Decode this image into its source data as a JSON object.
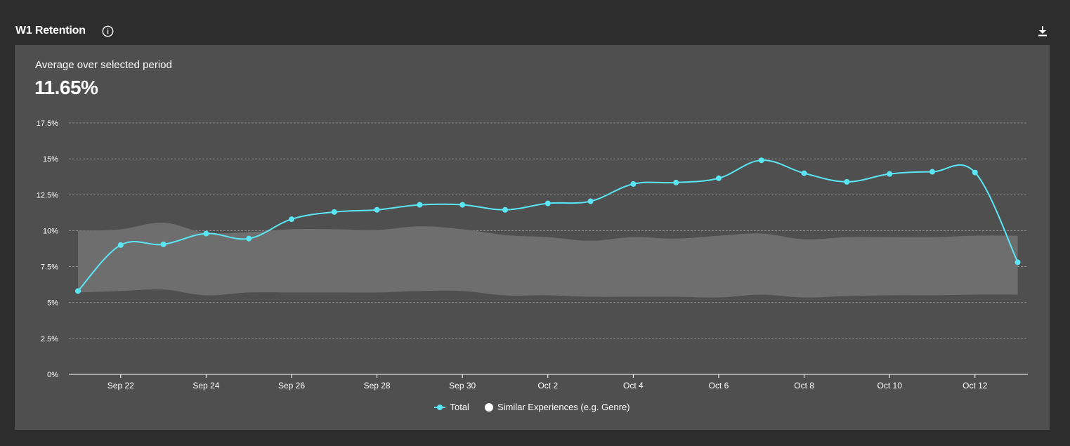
{
  "header": {
    "title": "W1 Retention",
    "info_icon": "info-circle-icon",
    "download_icon": "download-icon"
  },
  "summary": {
    "label": "Average over selected period",
    "value": "11.65%"
  },
  "colors": {
    "total": "#5ae6f5",
    "similar_band": "#6e6e6e",
    "panel": "#4f4f4f",
    "background": "#2d2d2d"
  },
  "chart_data": {
    "type": "line",
    "x": [
      "Sep 21",
      "Sep 22",
      "Sep 23",
      "Sep 24",
      "Sep 25",
      "Sep 26",
      "Sep 27",
      "Sep 28",
      "Sep 29",
      "Sep 30",
      "Oct 1",
      "Oct 2",
      "Oct 3",
      "Oct 4",
      "Oct 5",
      "Oct 6",
      "Oct 7",
      "Oct 8",
      "Oct 9",
      "Oct 10",
      "Oct 11",
      "Oct 12",
      "Oct 13"
    ],
    "x_tick_labels": [
      "Sep 22",
      "Sep 24",
      "Sep 26",
      "Sep 28",
      "Sep 30",
      "Oct 2",
      "Oct 4",
      "Oct 6",
      "Oct 8",
      "Oct 10",
      "Oct 12"
    ],
    "y_ticks": [
      "0%",
      "2.5%",
      "5%",
      "7.5%",
      "10%",
      "12.5%",
      "15%",
      "17.5%"
    ],
    "ylim": [
      0,
      17.5
    ],
    "grid": true,
    "legend_position": "bottom-center",
    "series": [
      {
        "name": "Total",
        "type": "line",
        "values": [
          5.8,
          9.0,
          9.05,
          9.8,
          9.45,
          10.8,
          11.3,
          11.45,
          11.8,
          11.8,
          11.45,
          11.9,
          12.05,
          13.25,
          13.35,
          13.65,
          14.9,
          14.0,
          13.4,
          13.95,
          14.1,
          14.05,
          7.8
        ]
      },
      {
        "name": "Similar Experiences (e.g. Genre)",
        "type": "band",
        "lower": [
          5.7,
          5.8,
          5.9,
          5.5,
          5.7,
          5.7,
          5.7,
          5.7,
          5.8,
          5.8,
          5.5,
          5.5,
          5.4,
          5.4,
          5.4,
          5.35,
          5.55,
          5.35,
          5.45,
          5.5,
          5.5,
          5.55,
          5.55
        ],
        "upper": [
          10.0,
          10.1,
          10.55,
          9.85,
          9.9,
          10.1,
          10.1,
          10.05,
          10.3,
          10.1,
          9.7,
          9.55,
          9.3,
          9.55,
          9.45,
          9.65,
          9.8,
          9.4,
          9.55,
          9.55,
          9.55,
          9.65,
          9.65
        ]
      }
    ]
  }
}
